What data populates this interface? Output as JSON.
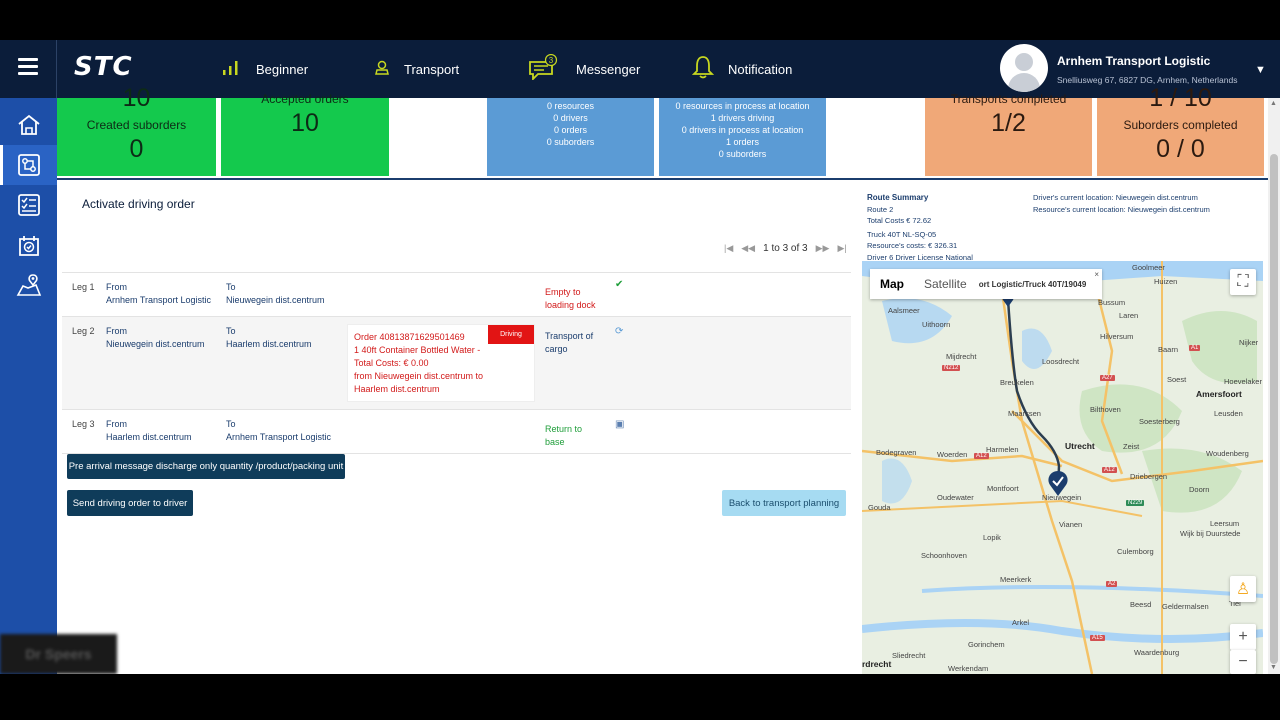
{
  "header": {
    "logo": "STC",
    "nav": [
      {
        "label": "Beginner",
        "icon": "signal-bars-icon"
      },
      {
        "label": "Transport",
        "icon": "user-icon"
      },
      {
        "label": "Messenger",
        "icon": "chat-icon",
        "badge": "3"
      },
      {
        "label": "Notification",
        "icon": "bell-icon"
      }
    ],
    "company_name": "Arnhem Transport Logistic",
    "company_address": "Snelliusweg 67, 6827 DG, Arnhem, Netherlands"
  },
  "sidebar": {
    "items": [
      "home-icon",
      "dashboard-icon",
      "checklist-icon",
      "calendar-icon",
      "map-route-icon"
    ],
    "active_index": 1
  },
  "stats": {
    "created_suborders": {
      "top_partial": "10",
      "label": "Created suborders",
      "value": "0"
    },
    "accepted_orders": {
      "top_partial": "Accepted orders",
      "value": "10"
    },
    "resources": {
      "lines": [
        "0 resources",
        "0 drivers",
        "0 orders",
        "0 suborders"
      ]
    },
    "in_process": {
      "lines": [
        "0 resources in process at location",
        "1 drivers driving",
        "0 drivers in process at location",
        "1 orders",
        "0 suborders"
      ]
    },
    "transports_completed": {
      "top_partial": "Transports completed",
      "value": "1/2"
    },
    "suborders_completed": {
      "top_partial": "1 / 10",
      "label": "Suborders completed",
      "value": "0 / 0"
    }
  },
  "panel": {
    "title": "Activate driving order",
    "pager": "1 to 3 of 3"
  },
  "legs": [
    {
      "leg": "Leg 1",
      "from_label": "From",
      "from": "Arnhem Transport Logistic",
      "to_label": "To",
      "to": "Nieuwegein dist.centrum",
      "status_1": "Empty to",
      "status_2": "loading dock",
      "status_color": "red",
      "icon": "check-icon"
    },
    {
      "leg": "Leg 2",
      "from_label": "From",
      "from": "Nieuwegein dist.centrum",
      "to_label": "To",
      "to": "Haarlem dist.centrum",
      "order": {
        "line1": "Order 40813871629501469",
        "line2": "1 40ft Container Bottled Water -",
        "line3": "Total Costs: € 0.00",
        "line4": "from Nieuwegein dist.centrum to",
        "line5": "Haarlem dist.centrum",
        "tag": "Driving"
      },
      "status_1": "Transport of",
      "status_2": "cargo",
      "status_color": "blue",
      "icon": "spinner-icon"
    },
    {
      "leg": "Leg 3",
      "from_label": "From",
      "from": "Haarlem dist.centrum",
      "to_label": "To",
      "to": "Arnhem Transport Logistic",
      "status_1": "Return to",
      "status_2": "base",
      "status_color": "green",
      "icon": "save-icon"
    }
  ],
  "buttons": {
    "pre_arrival": "Pre arrival message discharge only quantity /product/packing unit",
    "send_order": "Send driving order to driver",
    "back": "Back to transport planning"
  },
  "route_summary": {
    "title": "Route Summary",
    "route": "Route 2",
    "total_costs": "Total Costs € 72.62",
    "truck": "Truck 40T NL-SQ-05",
    "resource_costs": "Resource's costs: € 326.31",
    "driver": "Driver 6 Driver License National",
    "driver_location": "Driver's current location: Nieuwegein dist.centrum",
    "resource_location": "Resource's current location: Nieuwegein dist.centrum"
  },
  "map": {
    "tab_map": "Map",
    "tab_satellite": "Satellite",
    "tooltip": "ort Logistic/Truck 40T/19049",
    "tooltip_close": "×",
    "places": [
      "Goolmeer",
      "Huizen",
      "Aalsmeer",
      "Bussum",
      "Uithoorn",
      "Laren",
      "Hilversum",
      "Nijker",
      "Mijdrecht",
      "Loosdrecht",
      "Baarn",
      "Soest",
      "Hoevelaker",
      "Breukelen",
      "Amersfoort",
      "Maarssen",
      "Bilthoven",
      "Leusden",
      "Soesterberg",
      "Utrecht",
      "Zeist",
      "Bodegraven",
      "Woerden",
      "Harmelen",
      "Woudenberg",
      "Montfoort",
      "Driebergen",
      "Oudewater",
      "Nieuwegein",
      "Doorn",
      "Gouda",
      "Vianen",
      "Leersum",
      "Wijk bij Duurstede",
      "Lopik",
      "Culemborg",
      "Schoonhoven",
      "Meerkerk",
      "Beesd",
      "Geldermalsen",
      "Tiel",
      "Arkel",
      "Gorinchem",
      "Sliedrecht",
      "Waardenburg",
      "Werkendam",
      "rdrecht"
    ]
  }
}
